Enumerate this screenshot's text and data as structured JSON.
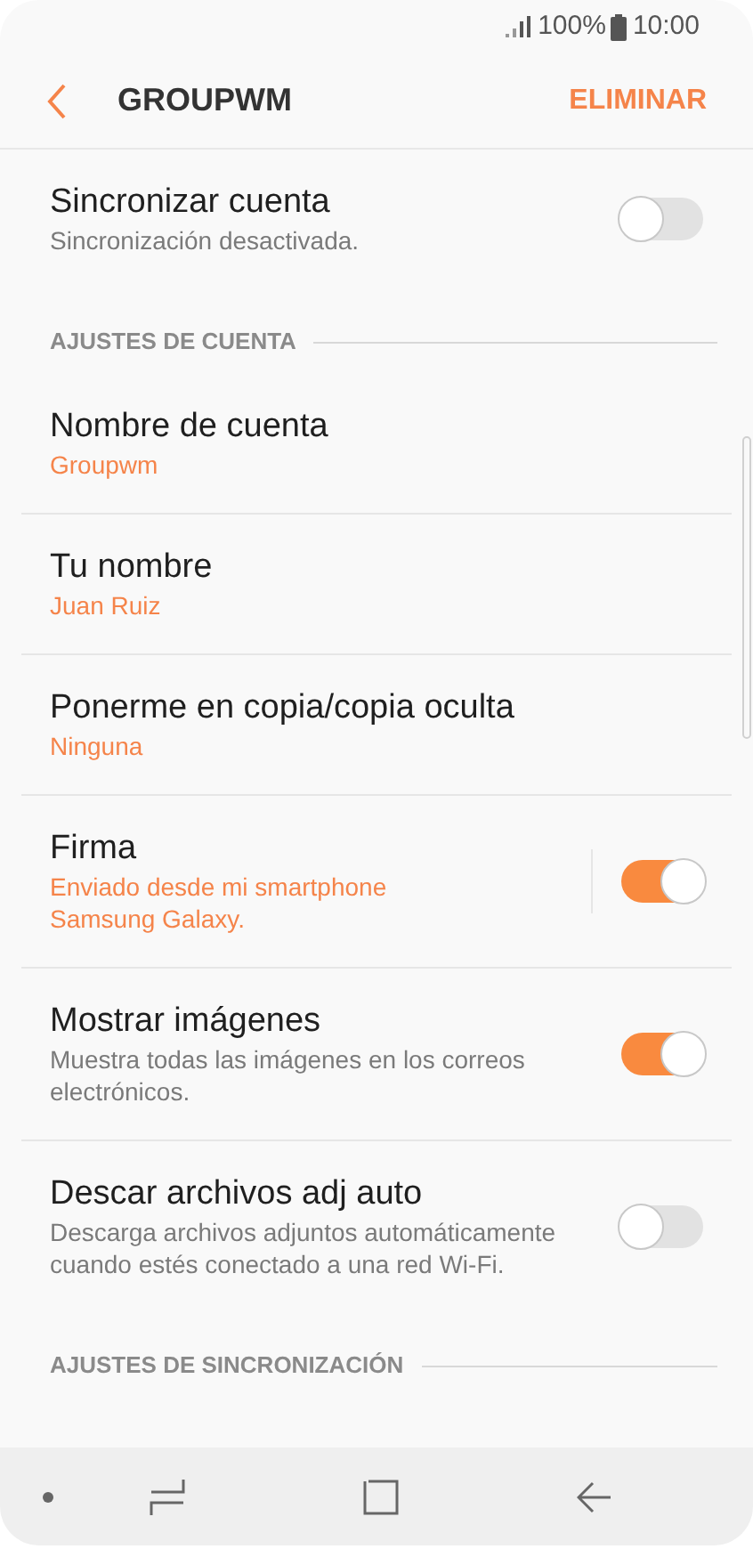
{
  "status_bar": {
    "battery": "100%",
    "time": "10:00"
  },
  "header": {
    "title": "GROUPWM",
    "action": "ELIMINAR"
  },
  "sections": [
    {
      "items": [
        {
          "kind": "switch",
          "title": "Sincronizar cuenta",
          "summary": "Sincronización desactivada.",
          "on": false
        }
      ]
    },
    {
      "title": "AJUSTES DE CUENTA",
      "items": [
        {
          "kind": "value",
          "title": "Nombre de cuenta",
          "summary": "Groupwm"
        },
        {
          "kind": "value",
          "title": "Tu nombre",
          "summary": "Juan Ruiz"
        },
        {
          "kind": "value",
          "title": "Ponerme en copia/copia oculta",
          "summary": "Ninguna"
        },
        {
          "kind": "value_switch",
          "title": "Firma",
          "summary": "Enviado desde mi smartphone Samsung Galaxy.",
          "on": true
        },
        {
          "kind": "switch",
          "title": "Mostrar imágenes",
          "summary": "Muestra todas las imágenes en los correos electrónicos.",
          "on": true
        },
        {
          "kind": "switch",
          "title": "Descar archivos adj auto",
          "summary": "Descarga archivos adjuntos automáticamente cuando estés conectado a una red Wi-Fi.",
          "on": false
        }
      ]
    },
    {
      "title": "AJUSTES DE SINCRONIZACIÓN"
    }
  ]
}
